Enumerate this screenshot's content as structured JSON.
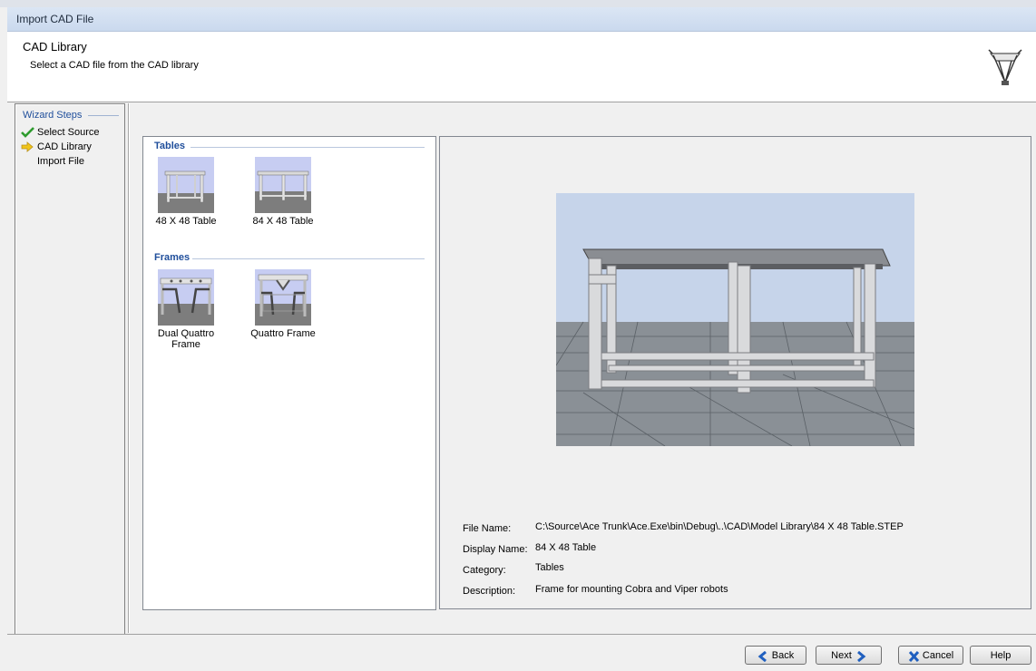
{
  "window": {
    "title": "Import CAD File"
  },
  "header": {
    "title": "CAD Library",
    "subtitle": "Select a CAD file from the CAD library",
    "logo_icon": "delta-robot-logo-icon"
  },
  "wizard": {
    "title": "Wizard Steps",
    "steps": [
      {
        "label": "Select Source",
        "status": "complete",
        "icon": "check-icon"
      },
      {
        "label": "CAD Library",
        "status": "current",
        "icon": "arrow-right-icon"
      },
      {
        "label": "Import File",
        "status": "pending",
        "icon": ""
      }
    ]
  },
  "library": {
    "groups": [
      {
        "title": "Tables",
        "items": [
          "48 X 48 Table",
          "84 X 48 Table"
        ]
      },
      {
        "title": "Frames",
        "items": [
          "Dual Quattro Frame",
          "Quattro Frame"
        ]
      }
    ],
    "selected": "84 X 48 Table"
  },
  "details": {
    "file_name_label": "File Name:",
    "file_name": "C:\\Source\\Ace Trunk\\Ace.Exe\\bin\\Debug\\..\\CAD\\Model Library\\84 X 48 Table.STEP",
    "display_name_label": "Display Name:",
    "display_name": "84 X 48 Table",
    "category_label": "Category:",
    "category": "Tables",
    "description_label": "Description:",
    "description": "Frame for mounting Cobra and Viper robots"
  },
  "buttons": {
    "back": "Back",
    "next": "Next",
    "cancel": "Cancel",
    "help": "Help"
  },
  "colors": {
    "accent": "#1f4e9b",
    "check": "#2e9b2e",
    "arrow": "#f0c419",
    "preview_sky": "#c6d4ea"
  }
}
